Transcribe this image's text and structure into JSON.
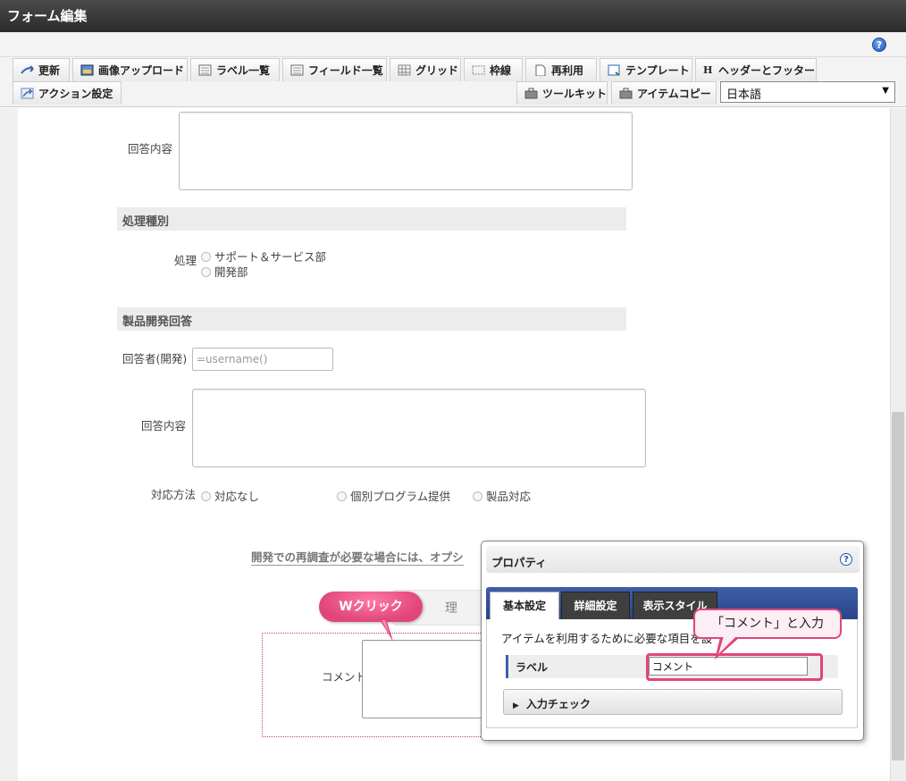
{
  "window": {
    "title": "フォーム編集"
  },
  "toolbar": {
    "row1": [
      {
        "label": "更新",
        "icon": "refresh-icon"
      },
      {
        "label": "画像アップロード",
        "icon": "image-upload-icon"
      },
      {
        "label": "ラベル一覧",
        "icon": "label-list-icon"
      },
      {
        "label": "フィールド一覧",
        "icon": "field-list-icon"
      },
      {
        "label": "グリッド",
        "icon": "grid-icon"
      },
      {
        "label": "枠線",
        "icon": "border-icon"
      },
      {
        "label": "再利用",
        "icon": "reuse-icon"
      },
      {
        "label": "テンプレート",
        "icon": "template-icon"
      },
      {
        "label": "ヘッダーとフッター",
        "icon": "header-footer-icon"
      }
    ],
    "row2": [
      {
        "label": "アクション設定",
        "icon": "action-icon"
      },
      {
        "label": "ツールキット",
        "icon": "toolkit-icon"
      },
      {
        "label": "アイテムコピー",
        "icon": "item-copy-icon"
      }
    ],
    "language": "日本語"
  },
  "form": {
    "answer_content_1": "回答内容",
    "section_process": "処理種別",
    "process_label": "処理",
    "process_options": [
      "サポート＆サービス部",
      "開発部"
    ],
    "section_dev": "製品開発回答",
    "responder_label": "回答者(開発)",
    "responder_placeholder": "=username()",
    "answer_content_2": "回答内容",
    "response_label": "対応方法",
    "response_options": [
      "対応なし",
      "個別プログラム提供",
      "製品対応"
    ],
    "note_text": "開発での再調査が必要な場合には、オプシ",
    "button_partial": "理",
    "comment_label": "コメント"
  },
  "properties": {
    "title": "プロパティ",
    "tabs": [
      "基本設定",
      "詳細設定",
      "表示スタイル"
    ],
    "description": "アイテムを利用するために必要な項目を設",
    "label_row": "ラベル",
    "label_value": "コメント",
    "accordion": "入力チェック"
  },
  "annotations": {
    "double_click": "Wクリック",
    "input_hint": "「コメント」と入力",
    "accent_color": "#e0457b"
  }
}
